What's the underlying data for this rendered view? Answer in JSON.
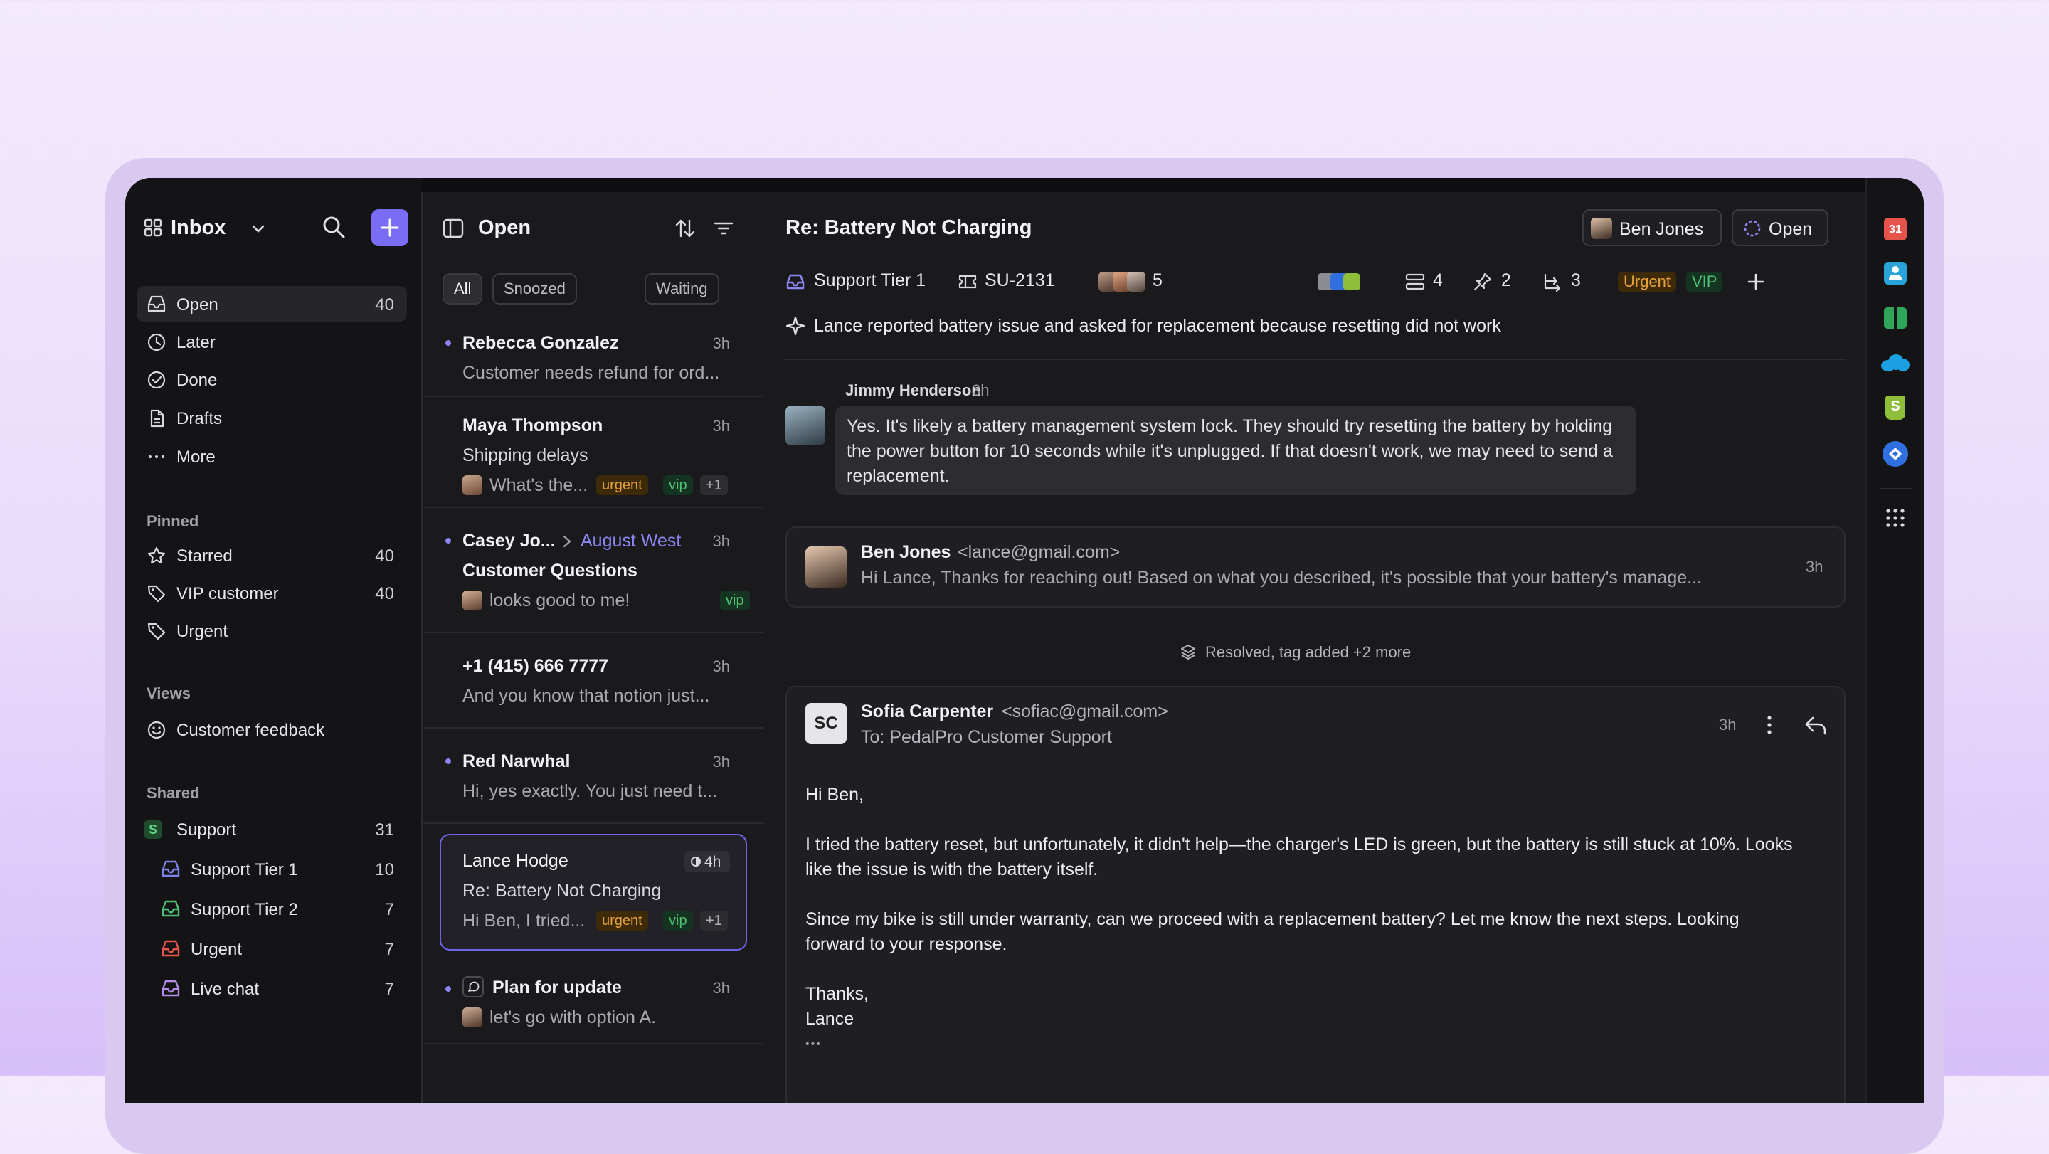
{
  "colors": {
    "accent": "#7b6cf6",
    "urgent": "#e8a23c",
    "vip": "#4fbf72",
    "dot": "#8b86f2"
  },
  "nav": {
    "title": "Inbox",
    "items": [
      {
        "label": "Open",
        "count": "40",
        "icon": "inbox-icon"
      },
      {
        "label": "Later",
        "count": "",
        "icon": "clock-icon"
      },
      {
        "label": "Done",
        "count": "",
        "icon": "check-circle-icon"
      },
      {
        "label": "Drafts",
        "count": "",
        "icon": "document-icon"
      },
      {
        "label": "More",
        "count": "",
        "icon": "more-horizontal-icon"
      }
    ],
    "pinned_title": "Pinned",
    "pinned": [
      {
        "label": "Starred",
        "count": "40",
        "icon": "star-icon"
      },
      {
        "label": "VIP customer",
        "count": "40",
        "icon": "tag-icon"
      },
      {
        "label": "Urgent",
        "count": "",
        "icon": "tag-icon"
      }
    ],
    "views_title": "Views",
    "views": [
      {
        "label": "Customer feedback",
        "icon": "smiley-icon"
      }
    ],
    "shared_title": "Shared",
    "shared": [
      {
        "label": "Support",
        "count": "31",
        "badge": "S"
      },
      {
        "label": "Support Tier 1",
        "count": "10",
        "color": "#7b82e8"
      },
      {
        "label": "Support Tier 2",
        "count": "7",
        "color": "#4fbf72"
      },
      {
        "label": "Urgent",
        "count": "7",
        "color": "#e5534b"
      },
      {
        "label": "Live chat",
        "count": "7",
        "color": "#b58de6"
      }
    ]
  },
  "list": {
    "title": "Open",
    "filters": [
      "All",
      "Snoozed",
      "Waiting"
    ],
    "conversations": [
      {
        "name": "Rebecca Gonzalez",
        "time": "3h",
        "preview": "Customer needs refund for ord..."
      },
      {
        "name": "Maya Thompson",
        "time": "3h",
        "subject": "Shipping delays",
        "preview": "What's the...",
        "tags": [
          "urgent",
          "vip",
          "+1"
        ]
      },
      {
        "name": "Casey Jo...",
        "assignee": "August West",
        "time": "3h",
        "subject": "Customer Questions",
        "preview": "looks good to me!",
        "tags": [
          "vip"
        ]
      },
      {
        "name": "+1 (415) 666 7777",
        "time": "3h",
        "preview": "And you know that notion just..."
      },
      {
        "name": "Red Narwhal",
        "time": "3h",
        "preview": "Hi, yes exactly. You just need t..."
      },
      {
        "name": "Lance Hodge",
        "time": "4h",
        "subject": "Re: Battery Not Charging",
        "preview": "Hi Ben, I tried...",
        "tags": [
          "urgent",
          "vip",
          "+1"
        ]
      },
      {
        "name": "Plan for update",
        "time": "3h",
        "preview": "let's go with option A."
      }
    ]
  },
  "detail": {
    "title": "Re: Battery Not Charging",
    "assignee": "Ben Jones",
    "status": "Open",
    "meta": {
      "inbox": "Support Tier 1",
      "ticket": "SU-2131",
      "participants": "5",
      "lists": "4",
      "pins": "2",
      "links": "3",
      "tags": [
        "Urgent",
        "VIP"
      ]
    },
    "summary": "Lance reported battery issue and asked for replacement because resetting did not work",
    "note": {
      "author": "Jimmy Henderson",
      "time": "3h",
      "text": "Yes. It's likely a battery management system lock. They should try resetting the battery by holding the power button for 10 seconds while it's unplugged. If that doesn't work, we may need to send a replacement."
    },
    "reply": {
      "author": "Ben Jones",
      "email": "<lance@gmail.com>",
      "time": "3h",
      "preview": "Hi Lance, Thanks for reaching out! Based on what you described, it's possible that your battery's manage..."
    },
    "event": "Resolved, tag added +2 more",
    "email": {
      "initials": "SC",
      "author": "Sofia Carpenter",
      "address": "<sofiac@gmail.com>",
      "to": "To: PedalPro Customer Support",
      "time": "3h",
      "greeting": "Hi Ben,",
      "p1": "I tried the battery reset, but unfortunately, it didn't help—the charger's LED is green, but the battery is still stuck at 10%. Looks",
      "p1b": "like the issue is with the battery itself.",
      "p2": "Since my bike is still under warranty, can we proceed with a replacement battery? Let me know the next steps. Looking",
      "p2b": "forward to your response.",
      "sign1": "Thanks,",
      "sign2": "Lance",
      "ellipsis": "•••"
    }
  },
  "apps": {
    "calendar_day": "31"
  }
}
